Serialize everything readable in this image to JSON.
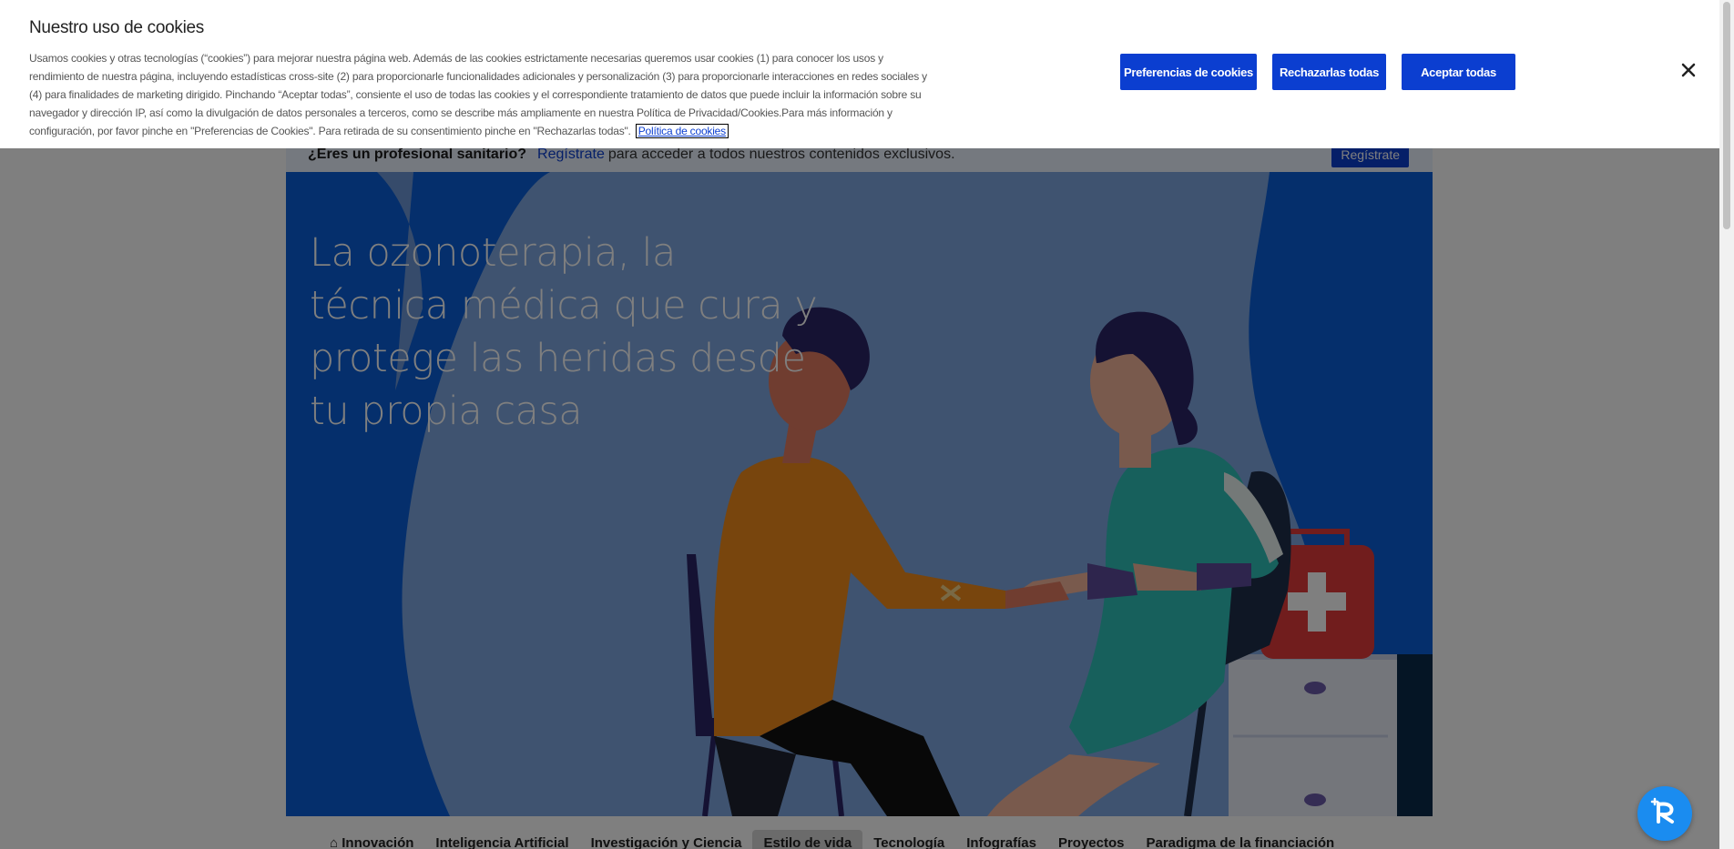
{
  "cookie_banner": {
    "title": "Nuestro uso de cookies",
    "body": "Usamos cookies y otras tecnologías (“cookies”) para mejorar nuestra página web. Además de las cookies estrictamente necesarias queremos usar cookies (1) para conocer los usos y rendimiento de nuestra página, incluyendo estadísticas cross-site (2) para proporcionarle funcionalidades adicionales y personalización (3) para proporcionarle interacciones en redes sociales y (4) para finalidades de marketing dirigido. Pinchando “Aceptar todas”, consiente el uso de todas las cookies y el correspondiente tratamiento de datos que puede incluir la información sobre su navegador y dirección IP, así como la divulgación de datos personales a terceros, como se describe más ampliamente en nuestra Política de Privacidad/Cookies.Para más información y configuración, por favor pinche en \"Preferencias de Cookies\". Para retirada de su consentimiento pinche en \"Rechazarlas todas\".",
    "policy_link": "Política de cookies",
    "buttons": {
      "preferences": "Preferencias de cookies",
      "reject": "Rechazarlas todas",
      "accept": "Aceptar todas"
    },
    "close_icon": "close-icon"
  },
  "pro_bar": {
    "question": "¿Eres un profesional sanitario?",
    "link": "Regístrate",
    "rest": "para acceder a todos nuestros contenidos exclusivos.",
    "button": "Regístrate"
  },
  "hero": {
    "title": "La ozonoterapia, la técnica médica que cura y protege las heridas desde tu propia casa"
  },
  "categories": [
    {
      "label": "Innovación",
      "icon": "home-icon"
    },
    {
      "label": "Inteligencia Artificial"
    },
    {
      "label": "Investigación y Ciencia"
    },
    {
      "label": "Estilo de vida",
      "active": true
    },
    {
      "label": "Tecnología"
    },
    {
      "label": "Infografías"
    },
    {
      "label": "Proyectos"
    },
    {
      "label": "Paradigma de la financiación"
    }
  ],
  "colors": {
    "accent": "#0b3ed0",
    "hero_bg": "#7ea6e0",
    "hero_wave": "#0b5ed8",
    "widget": "#1a8cf0"
  },
  "widget_icon": "accessibility-icon"
}
